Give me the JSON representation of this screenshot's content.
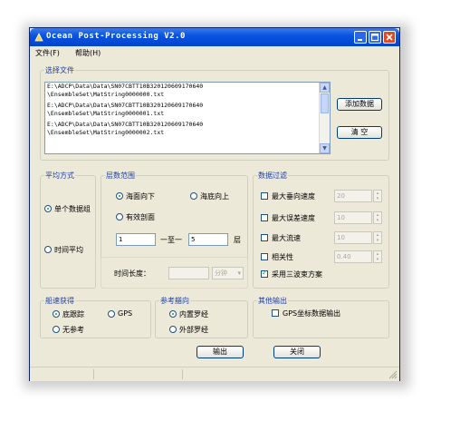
{
  "window": {
    "title": "Ocean Post-Processing V2.0"
  },
  "menu": {
    "file": "文件(F)",
    "help": "帮助(H)"
  },
  "file_select": {
    "group_label": "选择文件",
    "files": [
      {
        "line1": "E:\\ADCP\\Data\\Data\\SN07CBTT10B320120609170640",
        "line2": "\\EnsembleSet\\MatString0000000.txt"
      },
      {
        "line1": "E:\\ADCP\\Data\\Data\\SN07CBTT10B320120609170640",
        "line2": "\\EnsembleSet\\MatString0000001.txt"
      },
      {
        "line1": "E:\\ADCP\\Data\\Data\\SN07CBTT10B320120609170640",
        "line2": "\\EnsembleSet\\MatString0000002.txt"
      }
    ],
    "add_button": "添加数据",
    "clear_button": "清 空"
  },
  "averaging": {
    "group_label": "平均方式",
    "single_group": "单个数据组",
    "time_average": "时间平均",
    "selected": "single_group"
  },
  "layer_range": {
    "group_label": "层数范围",
    "surface_down": "海面向下",
    "bottom_up": "海底向上",
    "valid_profile": "有效剖面",
    "from_value": "1",
    "to_label": "一至一",
    "to_value": "5",
    "unit_label": "层",
    "selected": "surface_down",
    "time_length_label": "时间长度：",
    "time_length_value": "",
    "time_unit": "分钟"
  },
  "data_filter": {
    "group_label": "数据过滤",
    "items": [
      {
        "label": "最大垂向速度",
        "value": "20",
        "checked": false
      },
      {
        "label": "最大误差速度",
        "value": "10",
        "checked": false
      },
      {
        "label": "最大流速",
        "value": "10",
        "checked": false
      },
      {
        "label": "相关性",
        "value": "0.40",
        "checked": false
      }
    ],
    "three_beam_label": "采用三波束方案",
    "three_beam_checked": true
  },
  "ship_speed": {
    "group_label": "船速获得",
    "bottom_track": "底跟踪",
    "gps": "GPS",
    "no_reference": "无参考",
    "selected": "bottom_track"
  },
  "heading_ref": {
    "group_label": "参考艏向",
    "internal_compass": "内置罗经",
    "external_compass": "外部罗经",
    "selected": "internal_compass"
  },
  "other_output": {
    "group_label": "其他输出",
    "gps_output_label": "GPS坐标数据输出",
    "gps_output_checked": false
  },
  "footer": {
    "output_button": "输出",
    "close_button": "关闭"
  },
  "colors": {
    "titlebar": "#0a54e0",
    "group_label": "#1f3fa8",
    "window_bg": "#ece9d8",
    "close_button": "#e04a23"
  }
}
